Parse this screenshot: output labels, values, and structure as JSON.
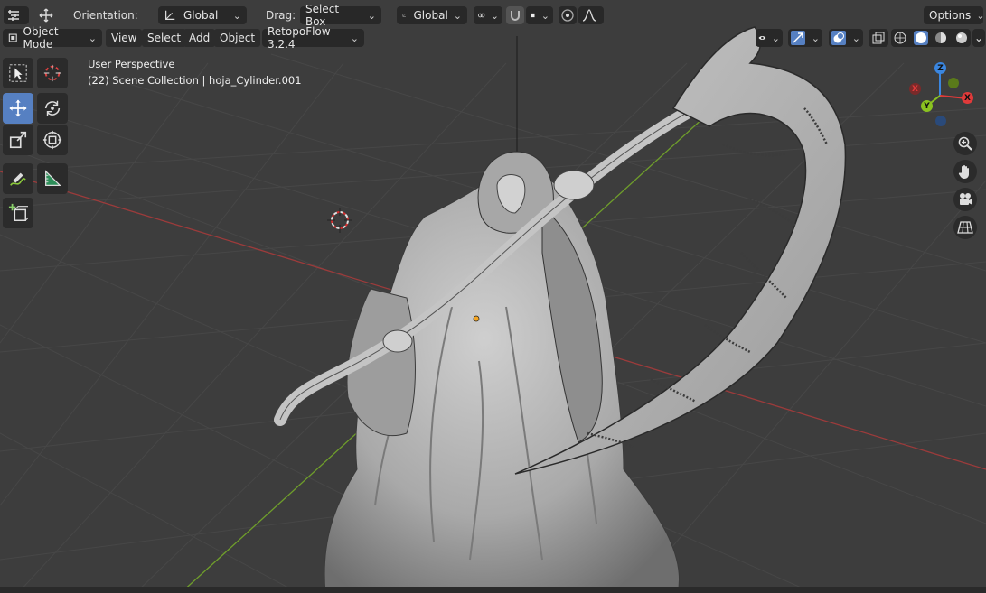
{
  "top_toolbar": {
    "orientation_label": "Orientation:",
    "orientation_value": "Global",
    "drag_label": "Drag:",
    "drag_value": "Select Box",
    "pivot_value": "Global",
    "options_label": "Options"
  },
  "header": {
    "mode_value": "Object Mode",
    "menus": [
      "View",
      "Select",
      "Add",
      "Object"
    ],
    "addon_value": "RetopoFlow 3.2.4"
  },
  "viewport": {
    "perspective_label": "User Perspective",
    "collection_label": "(22) Scene Collection | hoja_Cylinder.001"
  },
  "gizmo": {
    "x_label": "X",
    "y_label": "Y",
    "z_label": "Z",
    "x_color": "#e03a3a",
    "y_color": "#8ac220",
    "z_color": "#3a86e0"
  },
  "colors": {
    "viewport_bg": "#3d3d3d",
    "grid_line": "#464646",
    "x_axis_line": "#a23a3a",
    "y_axis_line": "#6a9a2a",
    "active_tool": "#5680c2",
    "model": "#b9b9b9"
  },
  "icons": {
    "tools": [
      "select-box-icon",
      "cursor-icon",
      "move-icon",
      "rotate-icon",
      "scale-icon",
      "transform-icon",
      "annotate-icon",
      "measure-icon",
      "add-cube-icon"
    ],
    "nav": [
      "zoom-icon",
      "hand-icon",
      "camera-icon",
      "grid-view-icon"
    ]
  }
}
